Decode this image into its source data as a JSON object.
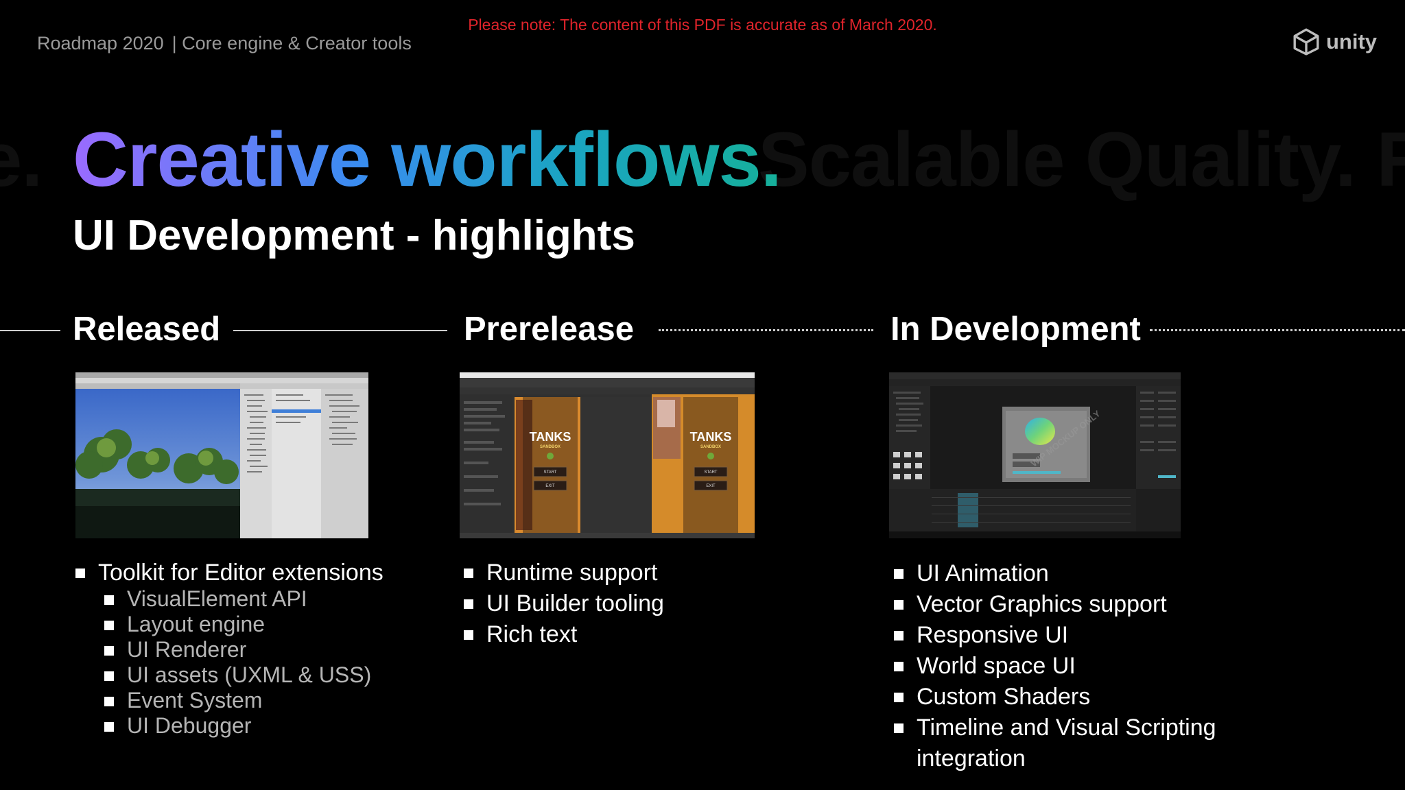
{
  "header": {
    "breadcrumb_left": "Roadmap 2020",
    "breadcrumb_right": "| Core engine & Creator tools",
    "notice": "Please note: The content of this PDF is accurate as of March 2020.",
    "logo_text": "unity"
  },
  "title": {
    "ghost_left": "e.",
    "main": "Creative workflows.",
    "ghost_right": "Scalable Quality.  Re",
    "subtitle": "UI Development - highlights"
  },
  "sections": [
    {
      "title": "Released",
      "items": [
        {
          "label": "Toolkit for Editor extensions",
          "children": [
            "VisualElement API",
            "Layout engine",
            "UI Renderer",
            "UI assets (UXML & USS)",
            "Event System",
            "UI Debugger"
          ]
        }
      ]
    },
    {
      "title": "Prerelease",
      "items": [
        "Runtime support",
        "UI Builder tooling",
        "Rich text"
      ],
      "screenshot_text": {
        "game_title": "TANKS",
        "game_subtitle": "SANDBOX",
        "start": "START",
        "exit": "EXIT"
      }
    },
    {
      "title": "In Development",
      "items": [
        "UI Animation",
        "Vector Graphics support",
        "Responsive UI",
        "World space UI",
        "Custom Shaders",
        "Timeline and Visual Scripting integration"
      ],
      "watermark": "WIP MOCKUP ONLY"
    }
  ],
  "colors": {
    "background": "#000000",
    "notice": "#e0242b",
    "gradient": [
      "#9a6bff",
      "#3a8cf0",
      "#16b09a"
    ]
  }
}
